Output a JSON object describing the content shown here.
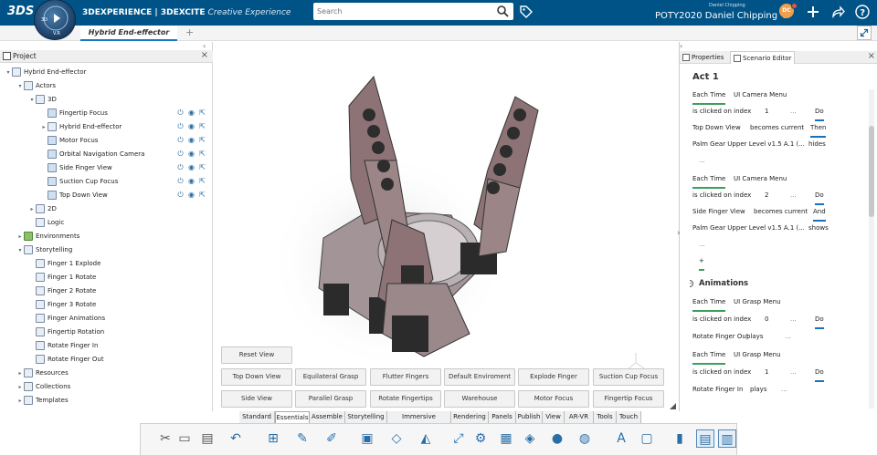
{
  "app": {
    "brand_bold": "3DEXPERIENCE | 3DEXCITE",
    "brand_light": "Creative Experience",
    "compass_version": "V.R",
    "logo": "3DS"
  },
  "search": {
    "placeholder": "Search"
  },
  "user": {
    "role": "Daniel Chipping",
    "name": "POTY2020 Daniel Chipping",
    "avatar": "DC"
  },
  "tabs": {
    "active": "Hybrid End-effector",
    "add": "+"
  },
  "project_panel": {
    "title": "Project",
    "tree": [
      {
        "label": "Hybrid End-effector",
        "depth": 0,
        "twisty": "expanded",
        "icon": "project-icon"
      },
      {
        "label": "Actors",
        "depth": 1,
        "twisty": "expanded",
        "icon": "actors-icon"
      },
      {
        "label": "3D",
        "depth": 2,
        "twisty": "expanded",
        "icon": "3d-icon"
      },
      {
        "label": "Fingertip Focus",
        "depth": 3,
        "twisty": "none",
        "icon": "camera-icon",
        "tools": true
      },
      {
        "label": "Hybrid End-effector",
        "depth": 3,
        "twisty": "collapsed",
        "icon": "product-icon",
        "tools": true
      },
      {
        "label": "Motor Focus",
        "depth": 3,
        "twisty": "none",
        "icon": "camera-icon",
        "tools": true
      },
      {
        "label": "Orbital Navigation Camera",
        "depth": 3,
        "twisty": "none",
        "icon": "camera-icon",
        "tools": true
      },
      {
        "label": "Side Finger View",
        "depth": 3,
        "twisty": "none",
        "icon": "camera-icon",
        "tools": true
      },
      {
        "label": "Suction Cup Focus",
        "depth": 3,
        "twisty": "none",
        "icon": "camera-icon",
        "tools": true
      },
      {
        "label": "Top Down View",
        "depth": 3,
        "twisty": "none",
        "icon": "camera-icon",
        "tools": true
      },
      {
        "label": "2D",
        "depth": 2,
        "twisty": "collapsed",
        "icon": "2d-icon"
      },
      {
        "label": "Logic",
        "depth": 2,
        "twisty": "none",
        "icon": "logic-icon"
      },
      {
        "label": "Environments",
        "depth": 1,
        "twisty": "collapsed",
        "icon": "environment-icon"
      },
      {
        "label": "Storytelling",
        "depth": 1,
        "twisty": "expanded",
        "icon": "storytelling-icon"
      },
      {
        "label": "Finger 1 Explode",
        "depth": 2,
        "twisty": "none",
        "icon": "animation-icon"
      },
      {
        "label": "Finger 1 Rotate",
        "depth": 2,
        "twisty": "none",
        "icon": "animation-icon"
      },
      {
        "label": "Finger 2 Rotate",
        "depth": 2,
        "twisty": "none",
        "icon": "animation-icon"
      },
      {
        "label": "Finger 3 Rotate",
        "depth": 2,
        "twisty": "none",
        "icon": "animation-icon"
      },
      {
        "label": "Finger Animations",
        "depth": 2,
        "twisty": "none",
        "icon": "animation-group-icon"
      },
      {
        "label": "Fingertip Rotation",
        "depth": 2,
        "twisty": "none",
        "icon": "animation-icon"
      },
      {
        "label": "Rotate Finger In",
        "depth": 2,
        "twisty": "none",
        "icon": "animation-icon"
      },
      {
        "label": "Rotate Finger Out",
        "depth": 2,
        "twisty": "none",
        "icon": "animation-icon"
      },
      {
        "label": "Resources",
        "depth": 1,
        "twisty": "collapsed",
        "icon": "resources-icon"
      },
      {
        "label": "Collections",
        "depth": 1,
        "twisty": "collapsed",
        "icon": "collections-icon"
      },
      {
        "label": "Templates",
        "depth": 1,
        "twisty": "collapsed",
        "icon": "templates-icon"
      }
    ]
  },
  "viewport": {
    "buttons_row1": [
      "Reset View"
    ],
    "buttons_row2": [
      "Top Down View",
      "Equilateral Grasp",
      "Flutter Fingers",
      "Default Enviroment",
      "Explode Finger",
      "Suction Cup Focus"
    ],
    "buttons_row3": [
      "Side View",
      "Parallel Grasp",
      "Rotate Fingertips",
      "Warehouse Enviroment",
      "Motor Focus",
      "Fingertip Focus"
    ]
  },
  "right_panel": {
    "tabs": [
      "Properties",
      "Scenario Editor"
    ],
    "act_title": "Act 1",
    "blocks": [
      {
        "trigger": "Each Time",
        "source": "UI Camera Menu",
        "cond_label": "is clicked on index",
        "index": "1",
        "ellipsis": "...",
        "op": "Do",
        "action1_left": "Top Down View",
        "action1_verb": "becomes current",
        "action1_op": "Then",
        "action2_left": "Palm Gear Upper Level v1.5 A.1 (...",
        "action2_verb": "hides",
        "more": "..."
      },
      {
        "trigger": "Each Time",
        "source": "UI Camera Menu",
        "cond_label": "is clicked on index",
        "index": "2",
        "ellipsis": "...",
        "op": "Do",
        "action1_left": "Side Finger View",
        "action1_verb": "becomes current",
        "action1_op": "And",
        "action2_left": "Palm Gear Upper Level v1.5 A.1 (...",
        "action2_verb": "shows",
        "more": "...",
        "add": "+"
      }
    ],
    "section_animations": "Animations",
    "anim_blocks": [
      {
        "trigger": "Each Time",
        "source": "UI Grasp Menu",
        "cond_label": "is clicked on index",
        "index": "0",
        "ellipsis": "...",
        "op": "Do",
        "action_left": "Rotate Finger Out",
        "action_verb": "plays",
        "more": "..."
      },
      {
        "trigger": "Each Time",
        "source": "UI Grasp Menu",
        "cond_label": "is clicked on index",
        "index": "1",
        "ellipsis": "...",
        "op": "Do",
        "action_left": "Rotate Finger In",
        "action_verb": "plays",
        "more": "..."
      }
    ]
  },
  "workbench_tabs": [
    "Standard",
    "Essentials",
    "Assemble",
    "Storytelling",
    "Immersive Virtuality",
    "Rendering",
    "Panels",
    "Publish",
    "View",
    "AR-VR",
    "Tools",
    "Touch"
  ],
  "workbench_active": "Essentials",
  "toolbar_icons": [
    "cut-icon",
    "copy-icon",
    "paste-icon",
    "undo-icon",
    "select-icon",
    "sketch-icon",
    "paint-icon",
    "camera-tool-icon",
    "box-icon",
    "shape-icon",
    "gizmo-icon",
    "robot-icon",
    "cube-group-icon",
    "material-icon",
    "ball-icon",
    "environment-sphere-icon",
    "text-tool-icon",
    "comment-icon",
    "book-icon",
    "layout-icon",
    "table-icon"
  ],
  "colors": {
    "topbar": "#005387",
    "accent": "#1279c2",
    "green_underline": "#3aa05a"
  }
}
